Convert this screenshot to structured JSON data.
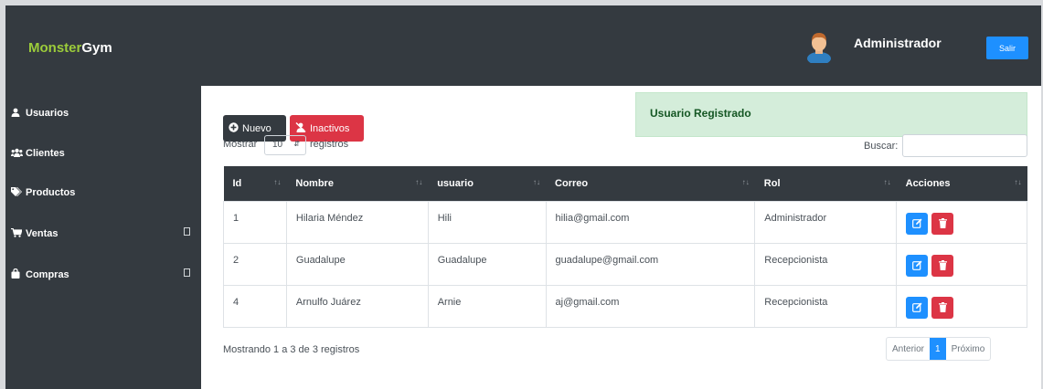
{
  "brand": {
    "part1": "Monster",
    "part2": "Gym"
  },
  "header": {
    "user_name": "Administrador",
    "logout_label": "Salir"
  },
  "sidebar": {
    "items": [
      {
        "label": "Usuarios",
        "icon": "user-icon"
      },
      {
        "label": "Clientes",
        "icon": "users-icon"
      },
      {
        "label": "Productos",
        "icon": "tags-icon"
      },
      {
        "label": "Ventas",
        "icon": "cart-icon"
      },
      {
        "label": "Compras",
        "icon": "shopping-bag-icon"
      }
    ]
  },
  "toolbar": {
    "new_label": "Nuevo",
    "inactive_label": "Inactivos"
  },
  "alert": {
    "text": "Usuario Registrado"
  },
  "length": {
    "prefix": "Mostrar",
    "value": "10",
    "suffix": "registros"
  },
  "search": {
    "label": "Buscar:",
    "value": ""
  },
  "table": {
    "headers": [
      "Id",
      "Nombre",
      "usuario",
      "Correo",
      "Rol",
      "Acciones"
    ],
    "rows": [
      {
        "id": "1",
        "nombre": "Hilaria Méndez",
        "usuario": "Hili",
        "correo": "hilia@gmail.com",
        "rol": "Administrador"
      },
      {
        "id": "2",
        "nombre": "Guadalupe",
        "usuario": "Guadalupe",
        "correo": "guadalupe@gmail.com",
        "rol": "Recepcionista"
      },
      {
        "id": "4",
        "nombre": "Arnulfo Juárez",
        "usuario": "Arnie",
        "correo": "aj@gmail.com",
        "rol": "Recepcionista"
      }
    ]
  },
  "footer": {
    "info": "Mostrando 1 a 3 de 3 registros",
    "prev_label": "Anterior",
    "page": "1",
    "next_label": "Próximo"
  },
  "colors": {
    "navbar": "#343a40",
    "primary": "#1e90ff",
    "danger": "#dc3545",
    "brand_green": "#9ccc3a",
    "alert_bg": "#d4edda"
  }
}
